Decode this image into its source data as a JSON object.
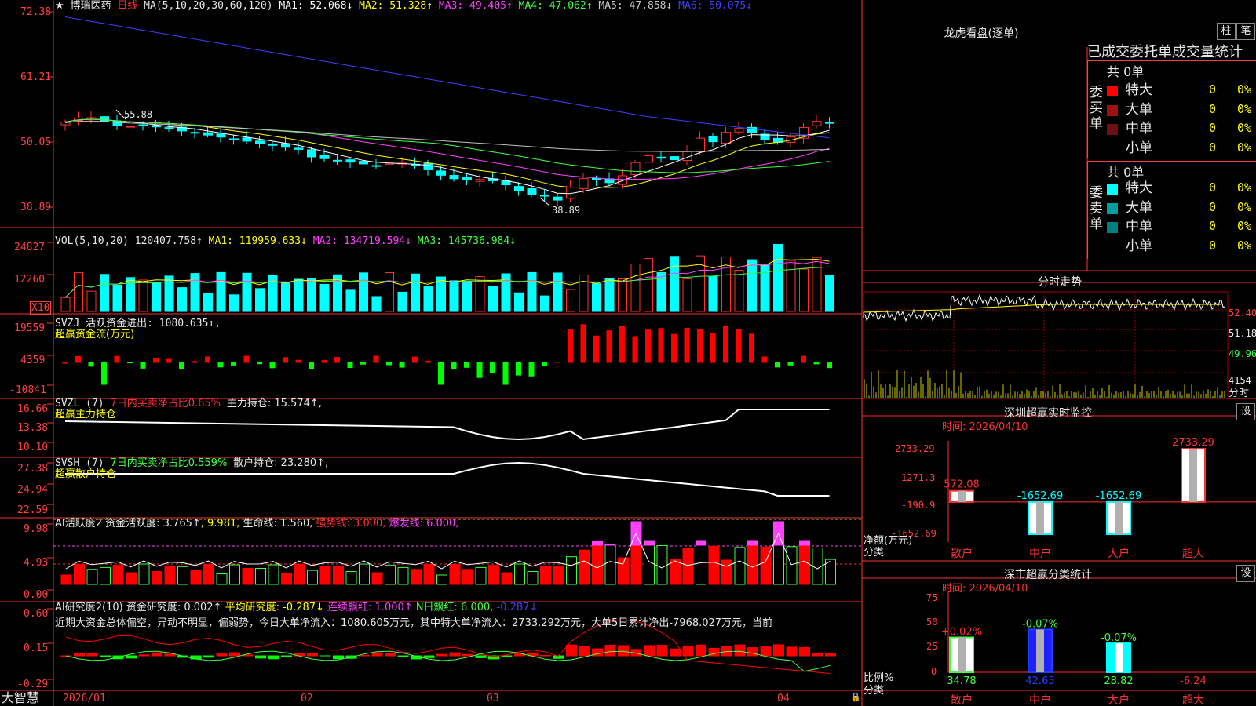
{
  "stock": {
    "star": "★",
    "name": "博瑞医药",
    "period": "日线"
  },
  "main_chart": {
    "ma_title": "MA(5,10,20,30,60,120)",
    "ma": [
      {
        "label": "MA1: 52.068↓",
        "color": "#ffffff"
      },
      {
        "label": "MA2: 51.328↑",
        "color": "#ffff00"
      },
      {
        "label": "MA3: 49.405↑",
        "color": "#ff40ff"
      },
      {
        "label": "MA4: 47.062↑",
        "color": "#40ff40"
      },
      {
        "label": "MA5: 47.858↓",
        "color": "#cccccc"
      },
      {
        "label": "MA6: 50.075↓",
        "color": "#4040ff"
      }
    ],
    "y_ticks": [
      "72.38",
      "61.21",
      "50.05",
      "38.89"
    ],
    "high_mark": "55.88",
    "low_mark": "38.89"
  },
  "vol_panel": {
    "title": "VOL(5,10,20)",
    "value": "120407.758↑",
    "ma1": "MA1: 119959.633↓",
    "ma2": "MA2: 134719.594↓",
    "ma3": "MA3: 145736.984↓",
    "y_ticks": [
      "24827",
      "12260"
    ],
    "unit": "X10"
  },
  "svzj_panel": {
    "title": "SVZJ  活跃资金进出: 1080.635↑,",
    "sub": "超赢资金流(万元)",
    "y_ticks": [
      "19559",
      "4359",
      "-10841"
    ]
  },
  "svzl_panel": {
    "title": "SVZL (7)",
    "pct": "7日内买卖净占比0.65%",
    "hold": "主力持仓: 15.574↑,",
    "sub": "超赢主力持仓",
    "y_ticks": [
      "16.66",
      "13.38",
      "10.10"
    ]
  },
  "svsh_panel": {
    "title": "SVSH (7)",
    "pct": "7日内买卖净占比0.559%",
    "hold": "散户持仓: 23.280↑,",
    "sub": "超赢散户持仓",
    "y_ticks": [
      "27.38",
      "24.94",
      "22.59"
    ]
  },
  "ai_active_panel": {
    "title": "AI活跃度2",
    "v1": "资金活跃度: 3.765↑",
    "v2": ", 9.981,",
    "v3": "生命线: 1.560,",
    "v4": "强势线: 3.000,",
    "v5": "爆发线: 6.000,",
    "y_ticks": [
      "9.98",
      "4.93",
      "0.00"
    ]
  },
  "ai_research_panel": {
    "title": "AI研究度2(10)",
    "v1": "资金研究度: 0.002↑",
    "v2": "平均研究度: -0.287↓",
    "v3": "连续飘红: 1.000↑",
    "v4": "N日飘红: 6.000,",
    "v5": "-0.287↓",
    "commentary": "近期大资金总体偏空，异动不明显，偏弱势，今日大单净流入：1080.605万元，其中特大单净流入：2733.292万元，大单5日累计净出-7968.027万元，当前",
    "y_ticks": [
      "0.60",
      "0.15",
      "-0.29"
    ]
  },
  "x_axis": {
    "brand": "大智慧",
    "labels": [
      "2026/01",
      "02",
      "03",
      "04"
    ]
  },
  "right": {
    "dragon_title": "龙虎看盘(逐单)",
    "tab_column": "柱",
    "tab_stroke": "笔",
    "stats_title": "已成交委托单成交量统计",
    "buy": {
      "group": "委买单",
      "total": "共 0单",
      "rows": [
        {
          "name": "特大",
          "count": "0",
          "pct": "0%",
          "color": "#ff0000"
        },
        {
          "name": "大单",
          "count": "0",
          "pct": "0%",
          "color": "#a01010"
        },
        {
          "name": "中单",
          "count": "0",
          "pct": "0%",
          "color": "#701010"
        },
        {
          "name": "小单",
          "count": "0",
          "pct": "0%",
          "color": "#000000"
        }
      ]
    },
    "sell": {
      "group": "委卖单",
      "total": "共 0单",
      "rows": [
        {
          "name": "特大",
          "count": "0",
          "pct": "0%",
          "color": "#00ffff"
        },
        {
          "name": "大单",
          "count": "0",
          "pct": "0%",
          "color": "#00a0a0"
        },
        {
          "name": "中单",
          "count": "0",
          "pct": "0%",
          "color": "#008080"
        },
        {
          "name": "小单",
          "count": "0",
          "pct": "0%",
          "color": "#000000"
        }
      ]
    },
    "intraday": {
      "title": "分时走势",
      "y_ticks": [
        "52.40",
        "51.18",
        "49.96"
      ],
      "vol_tick": "4154",
      "vol_label": "分时"
    },
    "sz_monitor": {
      "title": "深圳超赢实时监控",
      "setting": "设",
      "date": "时间: 2026/04/10",
      "y_ticks": [
        "2733.29",
        "1271.3",
        "-190.9",
        "-1652.69"
      ],
      "unit": "净额(万元)",
      "cat_label": "分类"
    },
    "sz_class": {
      "title": "深市超赢分类统计",
      "setting": "设",
      "date": "时间: 2026/04/10",
      "y_ticks": [
        "75",
        "50",
        "25",
        "0"
      ],
      "unit": "比例%",
      "cat_label": "分类"
    }
  },
  "chart_data": [
    {
      "type": "bar",
      "title": "深圳超赢实时监控",
      "ylabel": "净额(万元)",
      "categories": [
        "散户",
        "中户",
        "大户",
        "超大"
      ],
      "values": [
        572.08,
        -1652.69,
        -1652.69,
        2733.29
      ],
      "ylim": [
        -1652.69,
        2733.29
      ]
    },
    {
      "type": "bar",
      "title": "深市超赢分类统计",
      "ylabel": "比例%",
      "categories": [
        "散户",
        "中户",
        "大户",
        "超大"
      ],
      "values": [
        34.78,
        42.65,
        28.82,
        -6.24
      ],
      "changes": [
        "+0.02%",
        "-0.07%",
        "-0.07%",
        ""
      ],
      "ylim": [
        0,
        75
      ]
    }
  ]
}
